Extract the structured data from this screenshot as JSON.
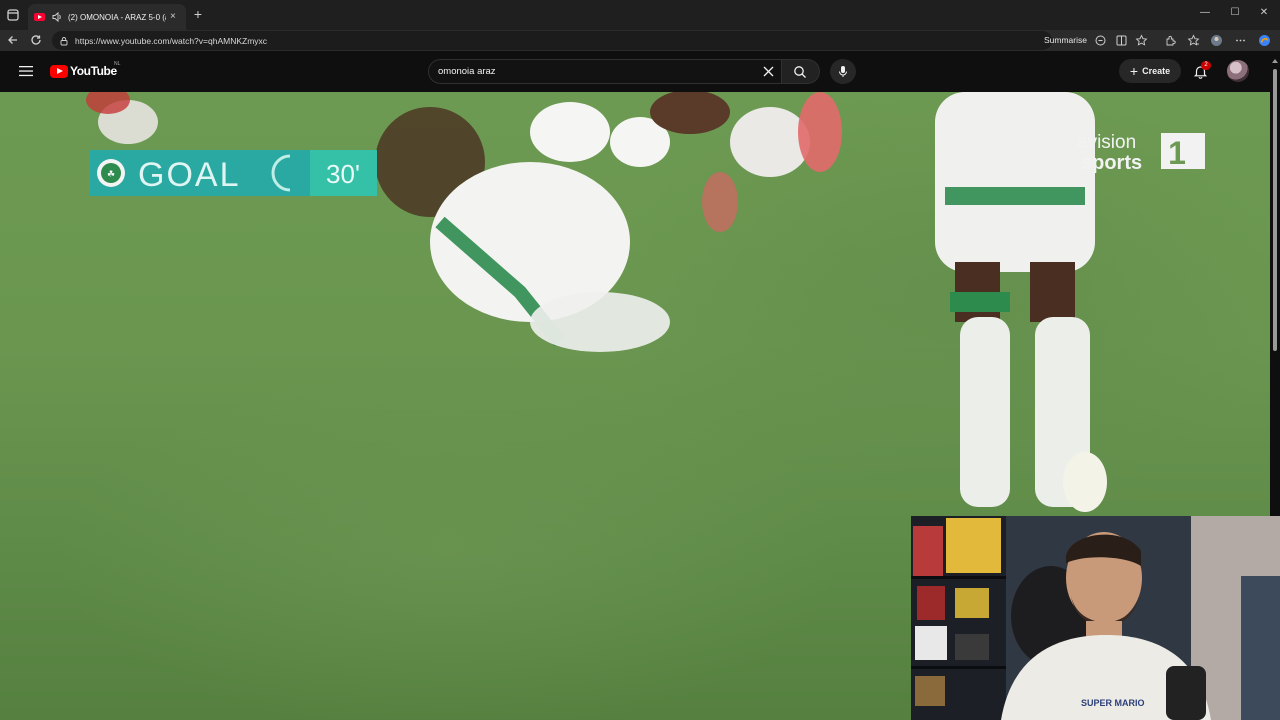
{
  "browser": {
    "tab": {
      "title": "(2) OMONOIA - ARAZ 5-0 (a",
      "close": "×"
    },
    "new_tab": "+",
    "window_controls": {
      "minimize": "—",
      "maximize": "☐",
      "close": "✕"
    },
    "url": "https://www.youtube.com/watch?v=qhAMNKZmyxc",
    "summarise_label": "Summarise"
  },
  "youtube": {
    "logo_text": "YouTube",
    "region": "NL",
    "search": {
      "value": "omonoia araz"
    },
    "create_label": "Create",
    "create_plus": "+",
    "notifications_count": "2"
  },
  "video": {
    "goal_graphic": {
      "label": "GOAL",
      "minute": "30'"
    },
    "broadcaster": {
      "line1": "avision",
      "line2": "sports",
      "channel": "1"
    }
  },
  "colors": {
    "accent": "#ff0000",
    "goal_banner": "#2fb7a8",
    "pitch": "#6a9650"
  }
}
